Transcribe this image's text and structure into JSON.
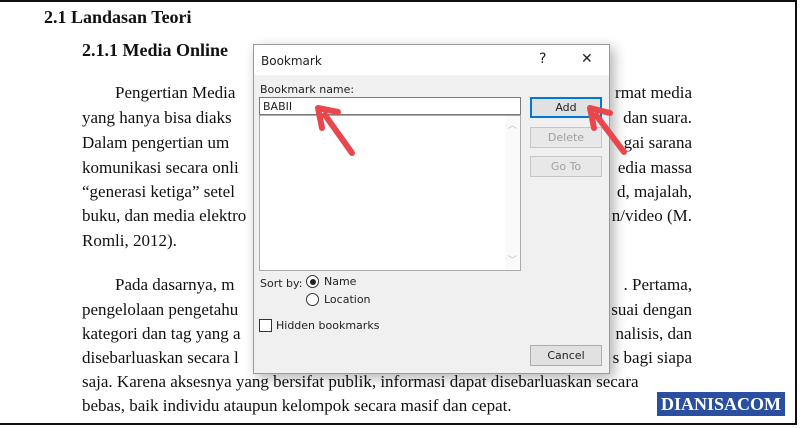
{
  "document": {
    "heading": "2.1  Landasan Teori",
    "subheading": "2.1.1    Media Online",
    "lines_left": [
      "Pengertian Media",
      "yang hanya bisa diaks",
      "Dalam pengertian um",
      "komunikasi secara onli",
      "“generasi ketiga” setel",
      "buku, dan media elektro",
      "Romli, 2012).",
      "Pada dasarnya, m",
      "pengelolaan pengetahu",
      "kategori dan tag yang a",
      "disebarluaskan secara l"
    ],
    "lines_right": [
      "rmat media",
      "dan suara.",
      "gai sarana",
      "edia massa",
      "d, majalah,",
      "n/video (M.",
      ". Pertama,",
      "suai dengan",
      "nalisis, dan",
      "s bagi siapa"
    ],
    "line_full_1": "saja. Karena aksesnya yang bersifat publik, informasi dapat disebarluaskan secara",
    "line_full_2": "bebas, baik individu ataupun kelompok secara masif dan cepat."
  },
  "dialog": {
    "title": "Bookmark",
    "help": "?",
    "close": "✕",
    "name_label": "Bookmark name:",
    "name_value": "BABII",
    "add": "Add",
    "delete": "Delete",
    "goto": "Go To",
    "cancel": "Cancel",
    "sort_by": "Sort by:",
    "sort_name": "Name",
    "sort_location": "Location",
    "sort_selected": "Name",
    "hidden": "Hidden bookmarks",
    "hidden_checked": false
  },
  "watermark": "DIANISACOM",
  "colors": {
    "arrow": "#e8474b",
    "watermark": "#2b4fa0",
    "focus": "#0078d7"
  }
}
